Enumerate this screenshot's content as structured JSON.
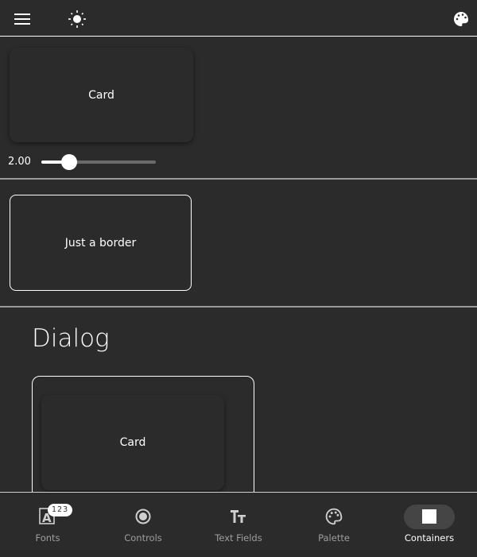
{
  "topbar": {
    "icons": [
      "menu-icon",
      "brightness-icon",
      "palette-icon"
    ]
  },
  "section1": {
    "card_label": "Card",
    "slider": {
      "value_label": "2.00",
      "fraction": 0.2
    }
  },
  "section2": {
    "card_label": "Just a border"
  },
  "section3": {
    "title": "Dialog",
    "card_label": "Card"
  },
  "nav": {
    "items": [
      {
        "label": "Fonts",
        "badge": "123"
      },
      {
        "label": "Controls"
      },
      {
        "label": "Text Fields"
      },
      {
        "label": "Palette"
      },
      {
        "label": "Containers",
        "active": true
      }
    ]
  }
}
